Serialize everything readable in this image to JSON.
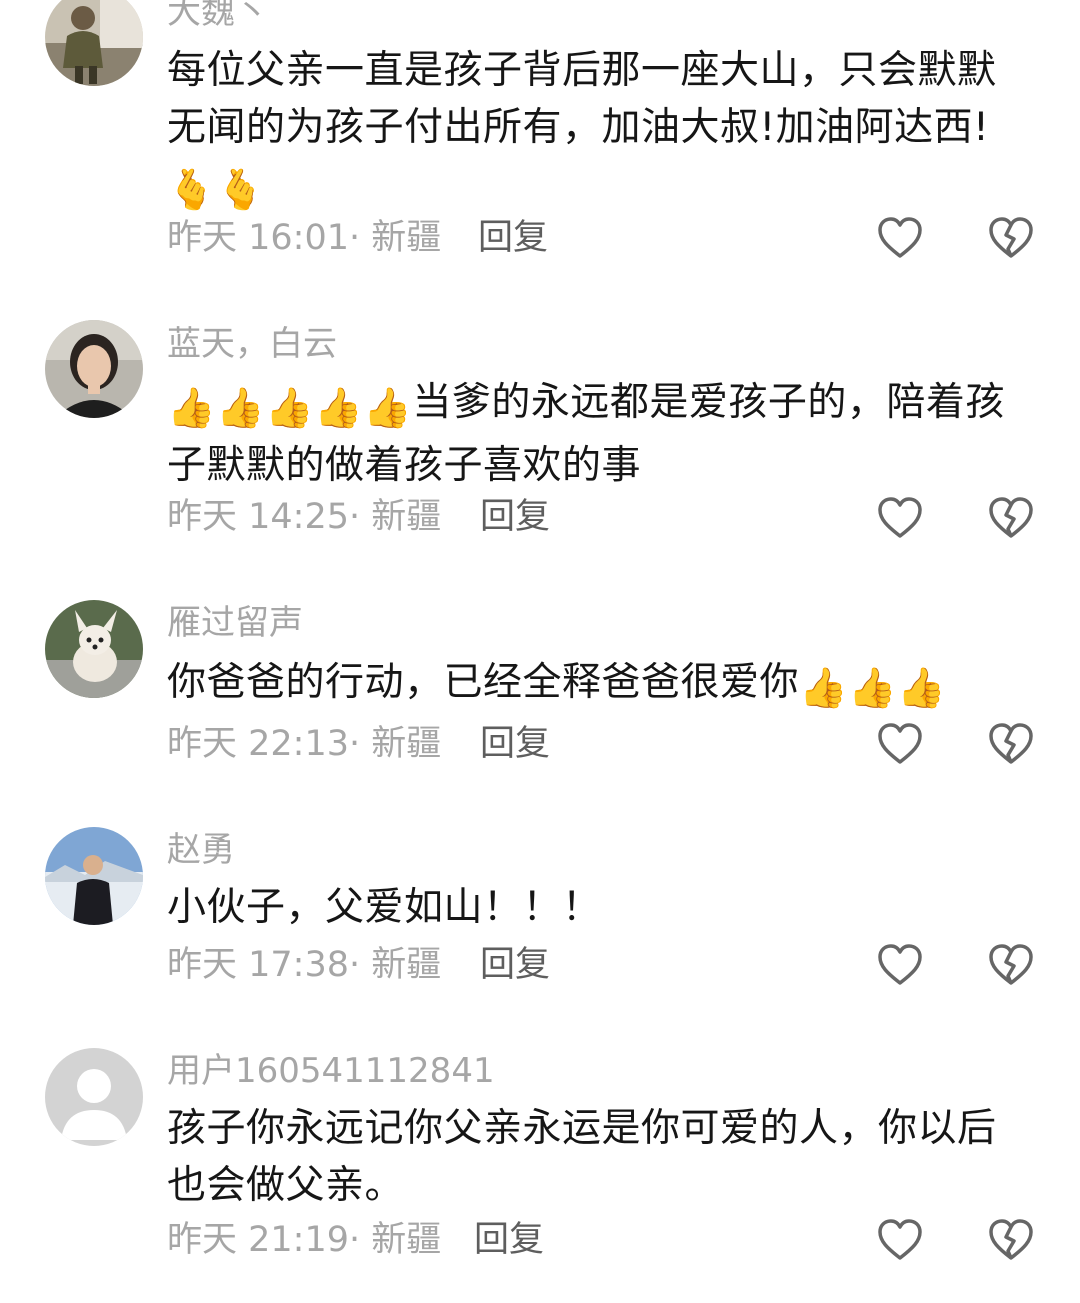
{
  "comments": [
    {
      "username": "大魏丶",
      "text": "每位父亲一直是孩子背后那一座大山，只会默默无闻的为孩子付出所有，加油大叔!加油阿达西!",
      "emoji": "🫰🫰",
      "time": "昨天 16:01",
      "location": "新疆",
      "reply_label": "回复"
    },
    {
      "username": "蓝天，白云",
      "emoji": "👍👍👍👍👍",
      "text": "当爹的永远都是爱孩子的，陪着孩子默默的做着孩子喜欢的事",
      "time": "昨天 14:25",
      "location": "新疆",
      "reply_label": "回复"
    },
    {
      "username": "雁过留声",
      "text": "你爸爸的行动，已经全释爸爸很爱你",
      "emoji": "👍👍👍",
      "time": "昨天 22:13",
      "location": "新疆",
      "reply_label": "回复"
    },
    {
      "username": "赵勇",
      "text": "小伙子，父爱如山！！！",
      "time": "昨天 17:38",
      "location": "新疆",
      "reply_label": "回复"
    },
    {
      "username": "用户160541112841",
      "text": "孩子你永远记你父亲永运是你可爱的人，你以后也会做父亲。",
      "time": "昨天 21:19",
      "location": "新疆",
      "reply_label": "回复"
    }
  ],
  "icons": {
    "like": "heart-outline-icon",
    "dislike": "broken-heart-icon",
    "default_avatar": "user-silhouette-icon"
  },
  "colors": {
    "username": "#a6a6a6",
    "text": "#161616",
    "meta": "#a6a6a6",
    "reply": "#5e5e5e",
    "icon": "#666666"
  }
}
